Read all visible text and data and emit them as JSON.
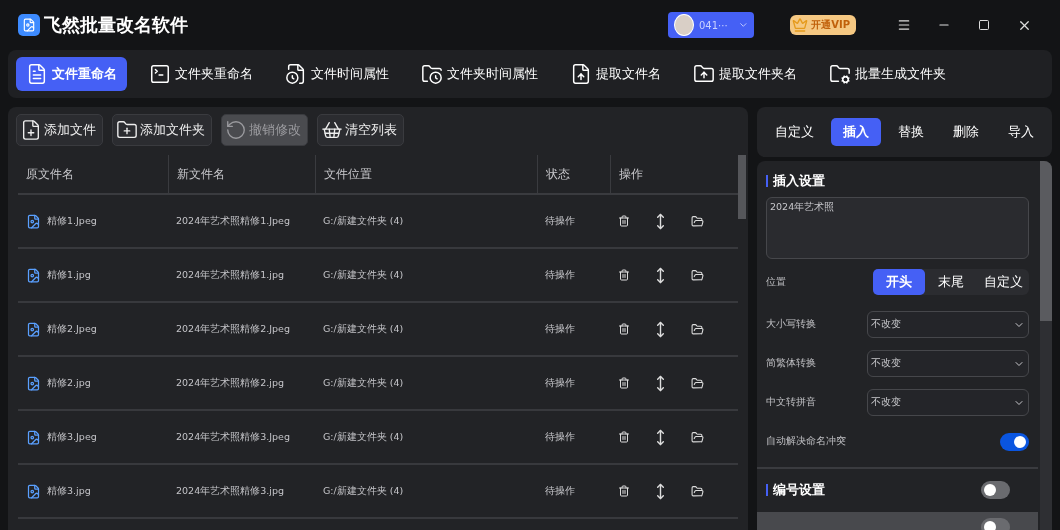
{
  "app": {
    "title": "飞然批量改名软件"
  },
  "user": {
    "name": "041···"
  },
  "vip": {
    "label": "开通VIP"
  },
  "nav": [
    {
      "label": "文件重命名",
      "kind": "file",
      "selected": true
    },
    {
      "label": "文件夹重命名",
      "kind": "terminal",
      "selected": false
    },
    {
      "label": "文件时间属性",
      "kind": "fileclock",
      "selected": false
    },
    {
      "label": "文件夹时间属性",
      "kind": "folderclock",
      "selected": false
    },
    {
      "label": "提取文件名",
      "kind": "fileup",
      "selected": false
    },
    {
      "label": "提取文件夹名",
      "kind": "folderup",
      "selected": false
    },
    {
      "label": "批量生成文件夹",
      "kind": "foldercog",
      "selected": false
    }
  ],
  "toolbar": [
    {
      "label": "添加文件",
      "kind": "fileplus",
      "disabled": false
    },
    {
      "label": "添加文件夹",
      "kind": "folderplus",
      "disabled": false
    },
    {
      "label": "撤销修改",
      "kind": "undo",
      "disabled": true
    },
    {
      "label": "清空列表",
      "kind": "basket",
      "disabled": false
    }
  ],
  "table": {
    "columns": [
      "原文件名",
      "新文件名",
      "文件位置",
      "状态",
      "操作"
    ],
    "rows": [
      {
        "original": "精修1.Jpeg",
        "new": "2024年艺术照精修1.Jpeg",
        "location": "G:/新建文件夹 (4)",
        "status": "待操作"
      },
      {
        "original": "精修1.jpg",
        "new": "2024年艺术照精修1.jpg",
        "location": "G:/新建文件夹 (4)",
        "status": "待操作"
      },
      {
        "original": "精修2.Jpeg",
        "new": "2024年艺术照精修2.Jpeg",
        "location": "G:/新建文件夹 (4)",
        "status": "待操作"
      },
      {
        "original": "精修2.jpg",
        "new": "2024年艺术照精修2.jpg",
        "location": "G:/新建文件夹 (4)",
        "status": "待操作"
      },
      {
        "original": "精修3.Jpeg",
        "new": "2024年艺术照精修3.Jpeg",
        "location": "G:/新建文件夹 (4)",
        "status": "待操作"
      },
      {
        "original": "精修3.jpg",
        "new": "2024年艺术照精修3.jpg",
        "location": "G:/新建文件夹 (4)",
        "status": "待操作"
      }
    ]
  },
  "mode_tabs": [
    {
      "label": "自定义",
      "selected": false
    },
    {
      "label": "插入",
      "selected": true
    },
    {
      "label": "替换",
      "selected": false
    },
    {
      "label": "删除",
      "selected": false
    },
    {
      "label": "导入",
      "selected": false
    }
  ],
  "insert": {
    "title": "插入设置",
    "text": "2024年艺术照",
    "position": {
      "label": "位置",
      "options": [
        {
          "label": "开头",
          "selected": true
        },
        {
          "label": "末尾",
          "selected": false
        },
        {
          "label": "自定义",
          "selected": false
        }
      ]
    },
    "selects": [
      {
        "label": "大小写转换",
        "value": "不改变"
      },
      {
        "label": "简繁体转换",
        "value": "不改变"
      },
      {
        "label": "中文转拼音",
        "value": "不改变"
      }
    ],
    "auto_resolve": {
      "label": "自动解决命名冲突",
      "on": true
    }
  },
  "numbering": {
    "title": "编号设置",
    "on": false,
    "option": {
      "on": false
    }
  }
}
